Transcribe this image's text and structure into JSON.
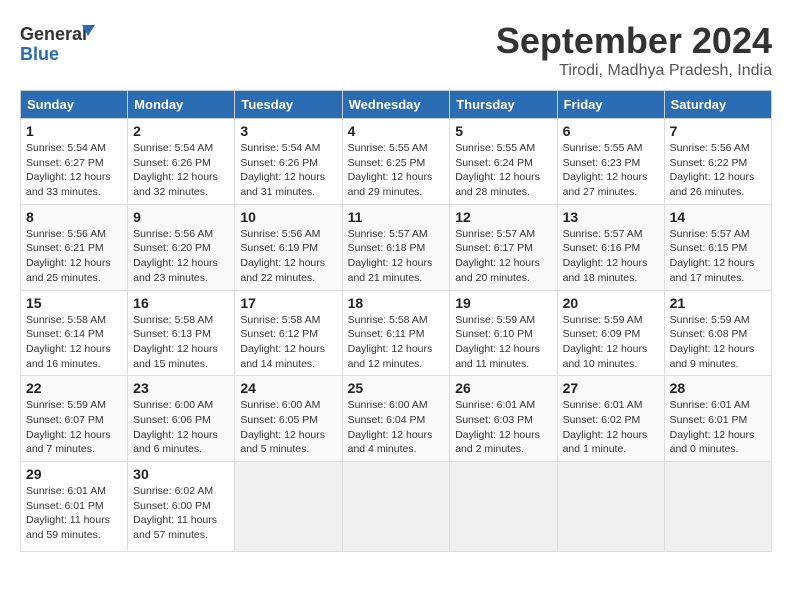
{
  "header": {
    "logo_line1": "General",
    "logo_line2": "Blue",
    "month": "September 2024",
    "location": "Tirodi, Madhya Pradesh, India"
  },
  "days_of_week": [
    "Sunday",
    "Monday",
    "Tuesday",
    "Wednesday",
    "Thursday",
    "Friday",
    "Saturday"
  ],
  "weeks": [
    [
      {
        "day": 1,
        "info": "Sunrise: 5:54 AM\nSunset: 6:27 PM\nDaylight: 12 hours\nand 33 minutes."
      },
      {
        "day": 2,
        "info": "Sunrise: 5:54 AM\nSunset: 6:26 PM\nDaylight: 12 hours\nand 32 minutes."
      },
      {
        "day": 3,
        "info": "Sunrise: 5:54 AM\nSunset: 6:26 PM\nDaylight: 12 hours\nand 31 minutes."
      },
      {
        "day": 4,
        "info": "Sunrise: 5:55 AM\nSunset: 6:25 PM\nDaylight: 12 hours\nand 29 minutes."
      },
      {
        "day": 5,
        "info": "Sunrise: 5:55 AM\nSunset: 6:24 PM\nDaylight: 12 hours\nand 28 minutes."
      },
      {
        "day": 6,
        "info": "Sunrise: 5:55 AM\nSunset: 6:23 PM\nDaylight: 12 hours\nand 27 minutes."
      },
      {
        "day": 7,
        "info": "Sunrise: 5:56 AM\nSunset: 6:22 PM\nDaylight: 12 hours\nand 26 minutes."
      }
    ],
    [
      {
        "day": 8,
        "info": "Sunrise: 5:56 AM\nSunset: 6:21 PM\nDaylight: 12 hours\nand 25 minutes."
      },
      {
        "day": 9,
        "info": "Sunrise: 5:56 AM\nSunset: 6:20 PM\nDaylight: 12 hours\nand 23 minutes."
      },
      {
        "day": 10,
        "info": "Sunrise: 5:56 AM\nSunset: 6:19 PM\nDaylight: 12 hours\nand 22 minutes."
      },
      {
        "day": 11,
        "info": "Sunrise: 5:57 AM\nSunset: 6:18 PM\nDaylight: 12 hours\nand 21 minutes."
      },
      {
        "day": 12,
        "info": "Sunrise: 5:57 AM\nSunset: 6:17 PM\nDaylight: 12 hours\nand 20 minutes."
      },
      {
        "day": 13,
        "info": "Sunrise: 5:57 AM\nSunset: 6:16 PM\nDaylight: 12 hours\nand 18 minutes."
      },
      {
        "day": 14,
        "info": "Sunrise: 5:57 AM\nSunset: 6:15 PM\nDaylight: 12 hours\nand 17 minutes."
      }
    ],
    [
      {
        "day": 15,
        "info": "Sunrise: 5:58 AM\nSunset: 6:14 PM\nDaylight: 12 hours\nand 16 minutes."
      },
      {
        "day": 16,
        "info": "Sunrise: 5:58 AM\nSunset: 6:13 PM\nDaylight: 12 hours\nand 15 minutes."
      },
      {
        "day": 17,
        "info": "Sunrise: 5:58 AM\nSunset: 6:12 PM\nDaylight: 12 hours\nand 14 minutes."
      },
      {
        "day": 18,
        "info": "Sunrise: 5:58 AM\nSunset: 6:11 PM\nDaylight: 12 hours\nand 12 minutes."
      },
      {
        "day": 19,
        "info": "Sunrise: 5:59 AM\nSunset: 6:10 PM\nDaylight: 12 hours\nand 11 minutes."
      },
      {
        "day": 20,
        "info": "Sunrise: 5:59 AM\nSunset: 6:09 PM\nDaylight: 12 hours\nand 10 minutes."
      },
      {
        "day": 21,
        "info": "Sunrise: 5:59 AM\nSunset: 6:08 PM\nDaylight: 12 hours\nand 9 minutes."
      }
    ],
    [
      {
        "day": 22,
        "info": "Sunrise: 5:59 AM\nSunset: 6:07 PM\nDaylight: 12 hours\nand 7 minutes."
      },
      {
        "day": 23,
        "info": "Sunrise: 6:00 AM\nSunset: 6:06 PM\nDaylight: 12 hours\nand 6 minutes."
      },
      {
        "day": 24,
        "info": "Sunrise: 6:00 AM\nSunset: 6:05 PM\nDaylight: 12 hours\nand 5 minutes."
      },
      {
        "day": 25,
        "info": "Sunrise: 6:00 AM\nSunset: 6:04 PM\nDaylight: 12 hours\nand 4 minutes."
      },
      {
        "day": 26,
        "info": "Sunrise: 6:01 AM\nSunset: 6:03 PM\nDaylight: 12 hours\nand 2 minutes."
      },
      {
        "day": 27,
        "info": "Sunrise: 6:01 AM\nSunset: 6:02 PM\nDaylight: 12 hours\nand 1 minute."
      },
      {
        "day": 28,
        "info": "Sunrise: 6:01 AM\nSunset: 6:01 PM\nDaylight: 12 hours\nand 0 minutes."
      }
    ],
    [
      {
        "day": 29,
        "info": "Sunrise: 6:01 AM\nSunset: 6:01 PM\nDaylight: 11 hours\nand 59 minutes."
      },
      {
        "day": 30,
        "info": "Sunrise: 6:02 AM\nSunset: 6:00 PM\nDaylight: 11 hours\nand 57 minutes."
      },
      null,
      null,
      null,
      null,
      null
    ]
  ]
}
